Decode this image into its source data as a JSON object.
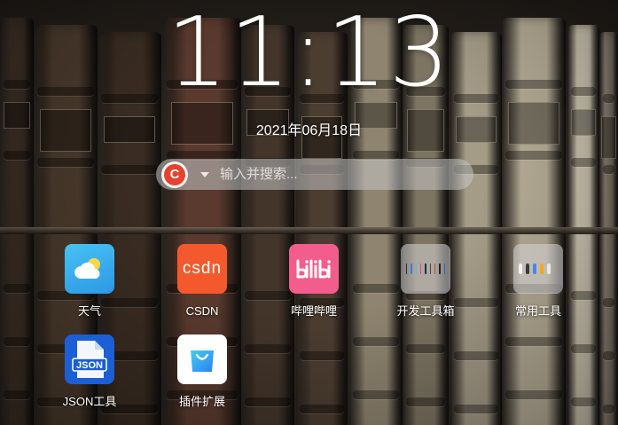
{
  "clock": {
    "time": "11:13",
    "date": "2021年06月18日"
  },
  "search": {
    "engine_icon": "c-logo-icon",
    "engine_letter": "C",
    "engine_color": "#e5432d",
    "placeholder": "输入并搜索..."
  },
  "apps": [
    {
      "label": "天气",
      "icon": "weather-icon"
    },
    {
      "label": "CSDN",
      "icon": "csdn-icon",
      "logo_text": "CSDN"
    },
    {
      "label": "哔哩哔哩",
      "icon": "bilibili-icon"
    },
    {
      "label": "开发工具箱",
      "icon": "folder-icon"
    },
    {
      "label": "常用工具",
      "icon": "folder-icon"
    },
    {
      "label": "JSON工具",
      "icon": "json-file-icon",
      "logo_text": "JSON"
    },
    {
      "label": "插件扩展",
      "icon": "shopping-bag-icon"
    }
  ],
  "colors": {
    "csdn": "#f4592e",
    "bilibili": "#f25d8e",
    "json": "#1c5fd4",
    "weather": "#3aaeee"
  }
}
